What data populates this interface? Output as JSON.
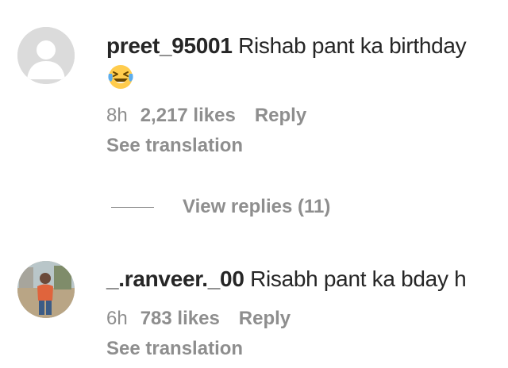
{
  "comments": [
    {
      "avatar": "default-avatar-icon",
      "username": "preet_95001",
      "text": " Rishab pant ka birthday",
      "emoji": "laughing-crying-emoji",
      "time": "8h",
      "likes": "2,217 likes",
      "reply": "Reply",
      "translation": "See translation",
      "view_replies": "View replies (11)"
    },
    {
      "avatar": "profile-photo",
      "username": "_.ranveer._00",
      "text": " Risabh pant ka bday h",
      "time": "6h",
      "likes": "783 likes",
      "reply": "Reply",
      "translation": "See translation"
    }
  ],
  "colors": {
    "text": "#262626",
    "secondary": "#8e8e8e",
    "avatar_default_bg": "#dbdbdb",
    "emoji_yellow": "#ffcc4d",
    "tear_blue": "#5dadec"
  }
}
